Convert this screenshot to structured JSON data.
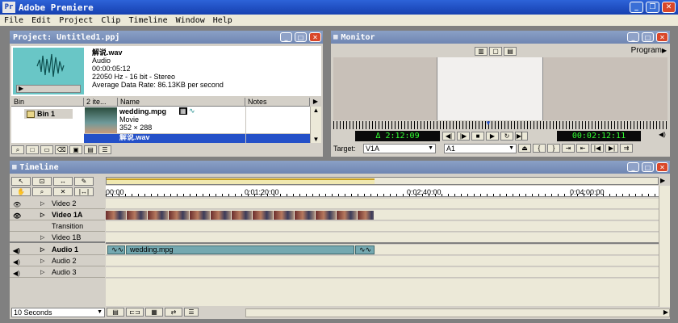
{
  "app": {
    "title": "Adobe Premiere"
  },
  "menu": [
    "File",
    "Edit",
    "Project",
    "Clip",
    "Timeline",
    "Window",
    "Help"
  ],
  "project": {
    "title": "Project: Untitled1.ppj",
    "clip": {
      "name": "解说.wav",
      "type": "Audio",
      "duration": "00:00:05:12",
      "format": "22050 Hz - 16 bit - Stereo",
      "rate": "Average Data Rate: 86.13KB per second"
    },
    "bin_header": "Bin",
    "bin_name": "Bin 1",
    "count_header": "2 ite...",
    "name_header": "Name",
    "notes_header": "Notes",
    "items": [
      {
        "name": "wedding.mpg",
        "type": "Movie",
        "size": "352 × 288"
      },
      {
        "name": "解说.wav",
        "type": "Audio"
      }
    ]
  },
  "monitor": {
    "title": "Monitor",
    "program_label": "Program",
    "left_timecode": "Δ 2:12:09",
    "right_timecode": "00:02:12:11",
    "target_label": "Target:",
    "target_video": "V1A",
    "target_audio": "A1"
  },
  "timeline": {
    "title": "Timeline",
    "ruler": [
      "00:00",
      "0:01:20:00",
      "0:02:40:00",
      "0:04:00:00"
    ],
    "tracks": [
      {
        "name": "Video 2",
        "eye": "👁"
      },
      {
        "name": "Video 1A",
        "eye": "👁"
      },
      {
        "name": "Transition",
        "eye": ""
      },
      {
        "name": "Video 1B",
        "eye": ""
      },
      {
        "name": "Audio 1",
        "eye": "◀)"
      },
      {
        "name": "Audio 2",
        "eye": "◀)"
      },
      {
        "name": "Audio 3",
        "eye": "◀)"
      }
    ],
    "audio_clip_label": "wedding.mpg",
    "zoom": "10 Seconds"
  }
}
